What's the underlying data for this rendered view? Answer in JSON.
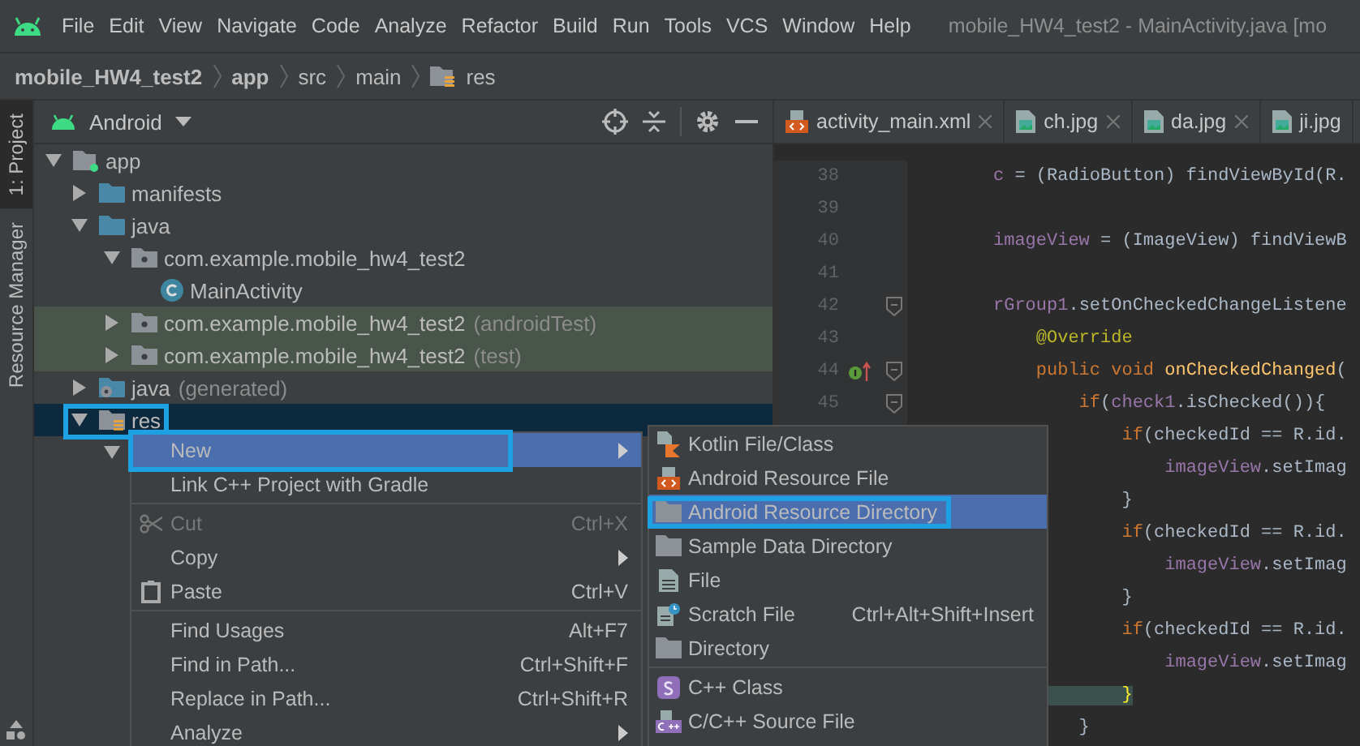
{
  "menu_bar": {
    "items": [
      "File",
      "Edit",
      "View",
      "Navigate",
      "Code",
      "Analyze",
      "Refactor",
      "Build",
      "Run",
      "Tools",
      "VCS",
      "Window",
      "Help"
    ],
    "title": "mobile_HW4_test2 - MainActivity.java [mo"
  },
  "breadcrumb": [
    {
      "label": "mobile_HW4_test2",
      "bold": true,
      "icon": false
    },
    {
      "label": "app",
      "bold": true,
      "icon": false
    },
    {
      "label": "src",
      "bold": false,
      "icon": false
    },
    {
      "label": "main",
      "bold": false,
      "icon": false
    },
    {
      "label": "res",
      "bold": false,
      "icon": true
    }
  ],
  "tool_tabs": [
    {
      "label": "1: Project",
      "selected": true
    },
    {
      "label": "Resource Manager",
      "selected": false
    }
  ],
  "project": {
    "view": "Android",
    "tree": [
      {
        "label": "app",
        "kind": "module",
        "expanded": true,
        "test": false,
        "selected": false,
        "annotated": false,
        "children": [
          {
            "label": "manifests",
            "kind": "folder",
            "expanded": false,
            "test": false,
            "selected": false,
            "annotated": false
          },
          {
            "label": "java",
            "kind": "folder",
            "expanded": true,
            "test": false,
            "selected": false,
            "annotated": false,
            "children": [
              {
                "label": "com.example.mobile_hw4_test2",
                "kind": "package",
                "expanded": true,
                "test": false,
                "selected": false,
                "annotated": false,
                "children": [
                  {
                    "label": "MainActivity",
                    "kind": "class",
                    "test": false,
                    "selected": false,
                    "annotated": false
                  }
                ]
              },
              {
                "label": "com.example.mobile_hw4_test2",
                "suffix": "(androidTest)",
                "kind": "package",
                "expanded": false,
                "test": true,
                "selected": false,
                "annotated": false
              },
              {
                "label": "com.example.mobile_hw4_test2",
                "suffix": "(test)",
                "kind": "package",
                "expanded": false,
                "test": true,
                "selected": false,
                "annotated": false
              }
            ]
          },
          {
            "label": "java",
            "suffix": "(generated)",
            "kind": "generated",
            "expanded": false,
            "test": false,
            "selected": false,
            "annotated": false
          },
          {
            "label": "res",
            "kind": "resources",
            "expanded": true,
            "test": false,
            "selected": true,
            "annotated": true,
            "children": [
              {
                "kind": "folder",
                "expanded": true,
                "test": false,
                "selected": false,
                "annotated": false
              }
            ]
          }
        ]
      }
    ]
  },
  "editor": {
    "tabs": [
      {
        "label": "activity_main.xml",
        "kind": "xml",
        "closable": true
      },
      {
        "label": "ch.jpg",
        "kind": "image",
        "closable": true
      },
      {
        "label": "da.jpg",
        "kind": "image",
        "closable": true
      },
      {
        "label": "ji.jpg",
        "kind": "image",
        "closable": false
      }
    ],
    "lines": [
      {
        "number": "38",
        "fold": false,
        "override": false,
        "code": [
          {
            "kind": "field",
            "text": "c"
          },
          {
            "kind": "plain",
            "text": " = (RadioButton) findViewById(R."
          }
        ]
      },
      {
        "number": "39",
        "fold": false,
        "override": false
      },
      {
        "number": "40",
        "fold": false,
        "override": false,
        "code": [
          {
            "kind": "field",
            "text": "imageView"
          },
          {
            "kind": "plain",
            "text": " = (ImageView) findViewB"
          }
        ]
      },
      {
        "number": "41",
        "fold": false,
        "override": false
      },
      {
        "number": "42",
        "fold": true,
        "override": false,
        "code": [
          {
            "kind": "field",
            "text": "rGroup1"
          },
          {
            "kind": "plain",
            "text": ".setOnCheckedChangeListene"
          }
        ]
      },
      {
        "number": "43",
        "fold": false,
        "override": false,
        "code": [
          {
            "kind": "annotation",
            "text": "    @Override"
          }
        ]
      },
      {
        "number": "44",
        "fold": true,
        "override": true,
        "code": [
          {
            "kind": "keyword",
            "text": "    public void "
          },
          {
            "kind": "method",
            "text": "onCheckedChanged"
          },
          {
            "kind": "plain",
            "text": "("
          }
        ]
      },
      {
        "number": "45",
        "fold": true,
        "override": false,
        "code": [
          {
            "kind": "keyword",
            "text": "        if"
          },
          {
            "kind": "plain",
            "text": "("
          },
          {
            "kind": "field",
            "text": "check1"
          },
          {
            "kind": "plain",
            "text": ".isChecked()){"
          }
        ]
      },
      {
        "code": [
          {
            "kind": "keyword",
            "text": "            if"
          },
          {
            "kind": "plain",
            "text": "(checkedId == R.id."
          }
        ]
      },
      {
        "code": [
          {
            "kind": "field",
            "text": "                imageView"
          },
          {
            "kind": "plain",
            "text": ".setImag"
          }
        ]
      },
      {
        "code": [
          {
            "kind": "plain",
            "text": "            }"
          }
        ]
      },
      {
        "code": [
          {
            "kind": "keyword",
            "text": "            if"
          },
          {
            "kind": "plain",
            "text": "(checkedId == R.id."
          }
        ]
      },
      {
        "code": [
          {
            "kind": "field",
            "text": "                imageView"
          },
          {
            "kind": "plain",
            "text": ".setImag"
          }
        ]
      },
      {
        "code": [
          {
            "kind": "plain",
            "text": "            }"
          }
        ]
      },
      {
        "code": [
          {
            "kind": "keyword",
            "text": "            if"
          },
          {
            "kind": "plain",
            "text": "(checkedId == R.id."
          }
        ]
      },
      {
        "code": [
          {
            "kind": "field",
            "text": "                imageView"
          },
          {
            "kind": "plain",
            "text": ".setImag"
          }
        ]
      },
      {
        "code": [
          {
            "kind": "match",
            "text": "            }"
          }
        ]
      },
      {
        "code": [
          {
            "kind": "plain",
            "text": "        }"
          }
        ]
      }
    ]
  },
  "context_menu": {
    "groups": [
      [
        {
          "label": "New",
          "kind": "plain",
          "submenu": true,
          "selected": true,
          "disabled": false,
          "annotated": true
        },
        {
          "label": "Link C++ Project with Gradle",
          "kind": "plain",
          "submenu": false,
          "selected": false,
          "disabled": false,
          "annotated": false
        }
      ],
      [
        {
          "label": "Cut",
          "kind": "cut",
          "shortcut": "Ctrl+X",
          "submenu": false,
          "selected": false,
          "disabled": true,
          "annotated": false
        },
        {
          "label": "Copy",
          "kind": "plain",
          "submenu": true,
          "selected": false,
          "disabled": false,
          "annotated": false
        },
        {
          "label": "Paste",
          "kind": "paste",
          "shortcut": "Ctrl+V",
          "submenu": false,
          "selected": false,
          "disabled": false,
          "annotated": false
        }
      ],
      [
        {
          "label": "Find Usages",
          "kind": "plain",
          "shortcut": "Alt+F7",
          "submenu": false,
          "selected": false,
          "disabled": false,
          "annotated": false
        },
        {
          "label": "Find in Path...",
          "kind": "plain",
          "shortcut": "Ctrl+Shift+F",
          "submenu": false,
          "selected": false,
          "disabled": false,
          "annotated": false
        },
        {
          "label": "Replace in Path...",
          "kind": "plain",
          "shortcut": "Ctrl+Shift+R",
          "submenu": false,
          "selected": false,
          "disabled": false,
          "annotated": false
        },
        {
          "label": "Analyze",
          "kind": "plain",
          "submenu": true,
          "selected": false,
          "disabled": false,
          "annotated": false
        }
      ]
    ]
  },
  "new_submenu": {
    "groups": [
      [
        {
          "label": "Kotlin File/Class",
          "kind": "kotlin",
          "selected": false,
          "annotated": false
        },
        {
          "label": "Android Resource File",
          "kind": "resource",
          "selected": false,
          "annotated": false
        },
        {
          "label": "Android Resource Directory",
          "kind": "directory",
          "selected": true,
          "annotated": true
        },
        {
          "label": "Sample Data Directory",
          "kind": "directory",
          "selected": false,
          "annotated": false
        },
        {
          "label": "File",
          "kind": "file",
          "selected": false,
          "annotated": false
        },
        {
          "label": "Scratch File",
          "kind": "scratch",
          "shortcut": "Ctrl+Alt+Shift+Insert",
          "selected": false,
          "annotated": false
        },
        {
          "label": "Directory",
          "kind": "directory",
          "selected": false,
          "annotated": false
        }
      ],
      [
        {
          "label": "C++ Class",
          "kind": "cppclass",
          "selected": false,
          "annotated": false
        },
        {
          "label": "C/C++ Source File",
          "kind": "cppsource",
          "selected": false,
          "annotated": false
        }
      ]
    ]
  }
}
